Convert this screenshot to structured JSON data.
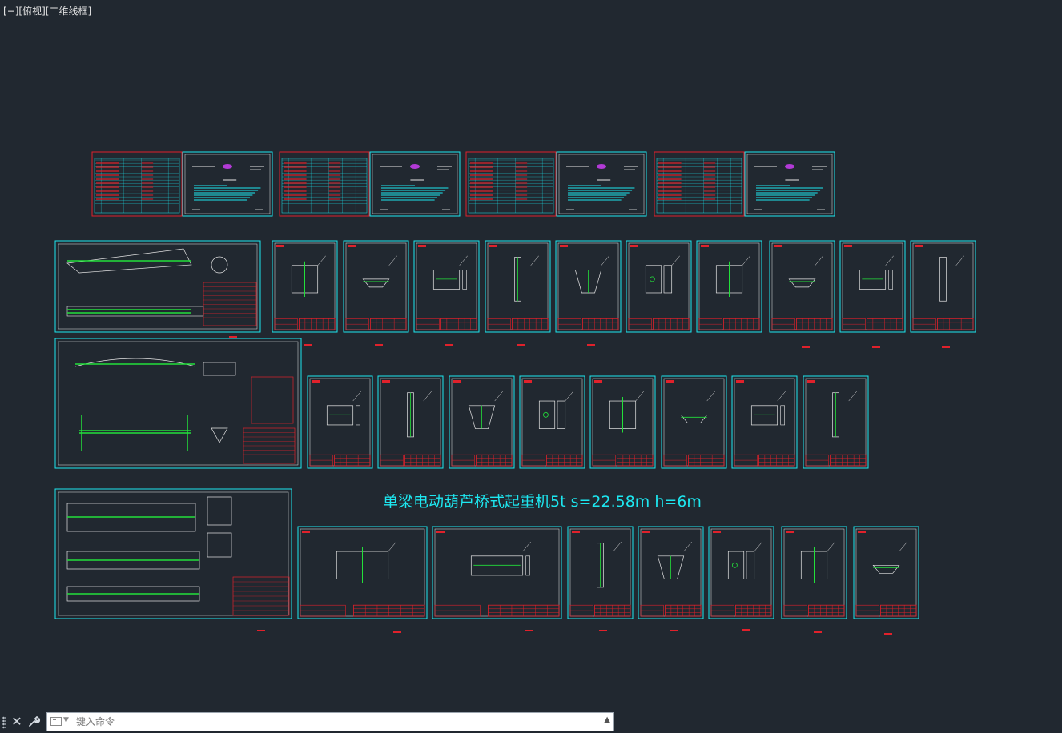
{
  "viewport": {
    "collapse": "[−]",
    "view": "[俯视]",
    "style": "[二维线框]"
  },
  "drawing_title": "单梁电动葫芦桥式起重机5t s=22.58m h=6m",
  "command_line": {
    "placeholder": "键入命令",
    "close_icon": "close-icon",
    "customize_icon": "wrench-icon"
  },
  "colors": {
    "background": "#212830",
    "sheet_border": "#1de7f0",
    "table_red": "#e0212b",
    "linework_green": "#23e03a",
    "linework_white": "#e6e6e6",
    "title_cyan": "#1de7f0"
  }
}
